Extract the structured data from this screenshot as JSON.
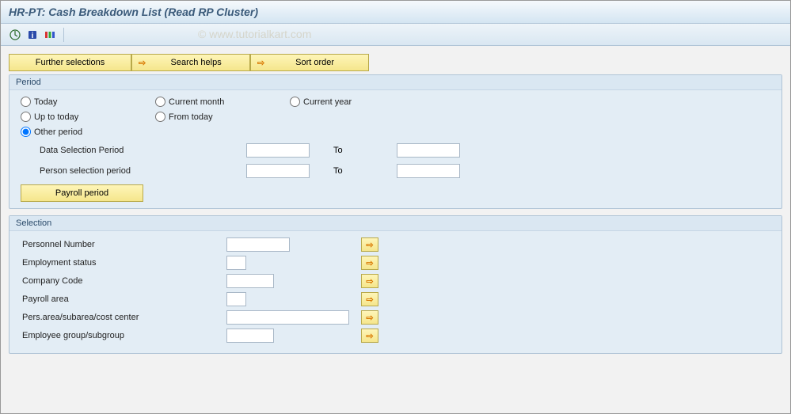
{
  "title": "HR-PT: Cash Breakdown List (Read RP Cluster)",
  "watermark": "© www.tutorialkart.com",
  "buttons": {
    "further_selections": "Further selections",
    "search_helps": "Search helps",
    "sort_order": "Sort order",
    "payroll_period": "Payroll period"
  },
  "period": {
    "title": "Period",
    "radios": {
      "today": "Today",
      "current_month": "Current month",
      "current_year": "Current year",
      "up_to_today": "Up to today",
      "from_today": "From today",
      "other_period": "Other period"
    },
    "selected": "other_period",
    "labels": {
      "data_selection": "Data Selection Period",
      "person_selection": "Person selection period",
      "to": "To"
    },
    "values": {
      "data_from": "",
      "data_to": "",
      "person_from": "",
      "person_to": ""
    }
  },
  "selection": {
    "title": "Selection",
    "rows": [
      {
        "label": "Personnel Number",
        "width": "w80",
        "value": ""
      },
      {
        "label": "Employment status",
        "width": "w30",
        "value": ""
      },
      {
        "label": "Company Code",
        "width": "w60",
        "value": ""
      },
      {
        "label": "Payroll area",
        "width": "w30",
        "value": ""
      },
      {
        "label": "Pers.area/subarea/cost center",
        "width": "w130",
        "value": ""
      },
      {
        "label": "Employee group/subgroup",
        "width": "w60",
        "value": ""
      }
    ]
  }
}
